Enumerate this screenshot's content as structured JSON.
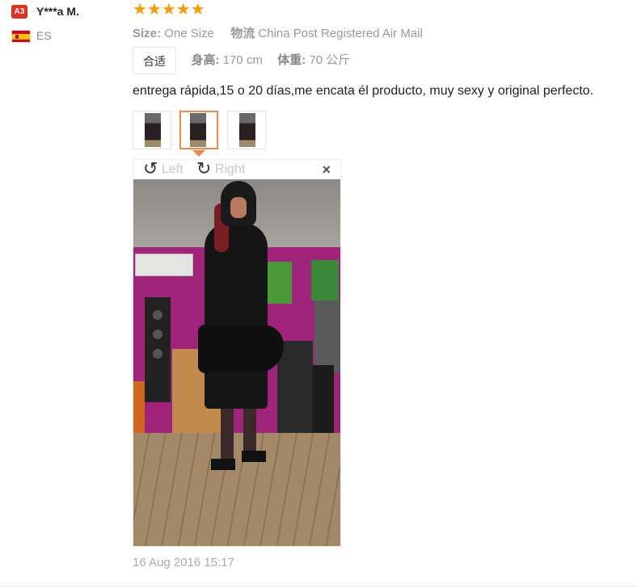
{
  "user": {
    "level_badge": "A3",
    "name": "Y***a M.",
    "country": "ES"
  },
  "review": {
    "stars": "★★★★★",
    "rating": 5,
    "size_label": "Size:",
    "size_value": "One Size",
    "shipping_label": "物流",
    "shipping_value": "China Post Registered Air Mail",
    "fit_chip": "合适",
    "height_label": "身高:",
    "height_value": "170 cm",
    "weight_label": "体重:",
    "weight_value": "70 公斤",
    "text": "entrega rápida,15 o 20 días,me encata él producto, muy sexy y original perfecto.",
    "date": "16 Aug 2016 15:17"
  },
  "viewer": {
    "rotate_left": "Left",
    "rotate_right": "Right",
    "close": "×",
    "rotate_left_icon": "↺",
    "rotate_right_icon": "↻"
  },
  "colors": {
    "badge": "#e0301e",
    "stars": "#ff9a00",
    "active_thumb": "#f08a4b"
  }
}
